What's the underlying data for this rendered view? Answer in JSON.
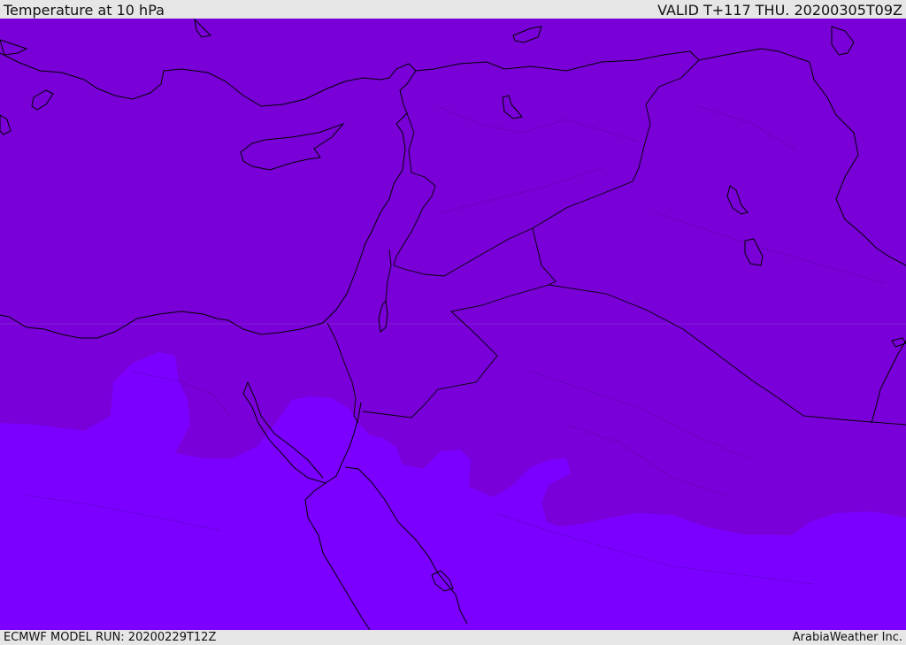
{
  "header": {
    "title": "Temperature at 10 hPa",
    "valid": "VALID T+117 THU. 20200305T09Z"
  },
  "footer": {
    "model_run": "ECMWF MODEL RUN: 20200229T12Z",
    "credit": "ArabiaWeather Inc."
  },
  "map": {
    "colors": {
      "warmer_band": "#7a00d9",
      "colder_band": "#7b00ff",
      "coastline": "#000000"
    }
  }
}
